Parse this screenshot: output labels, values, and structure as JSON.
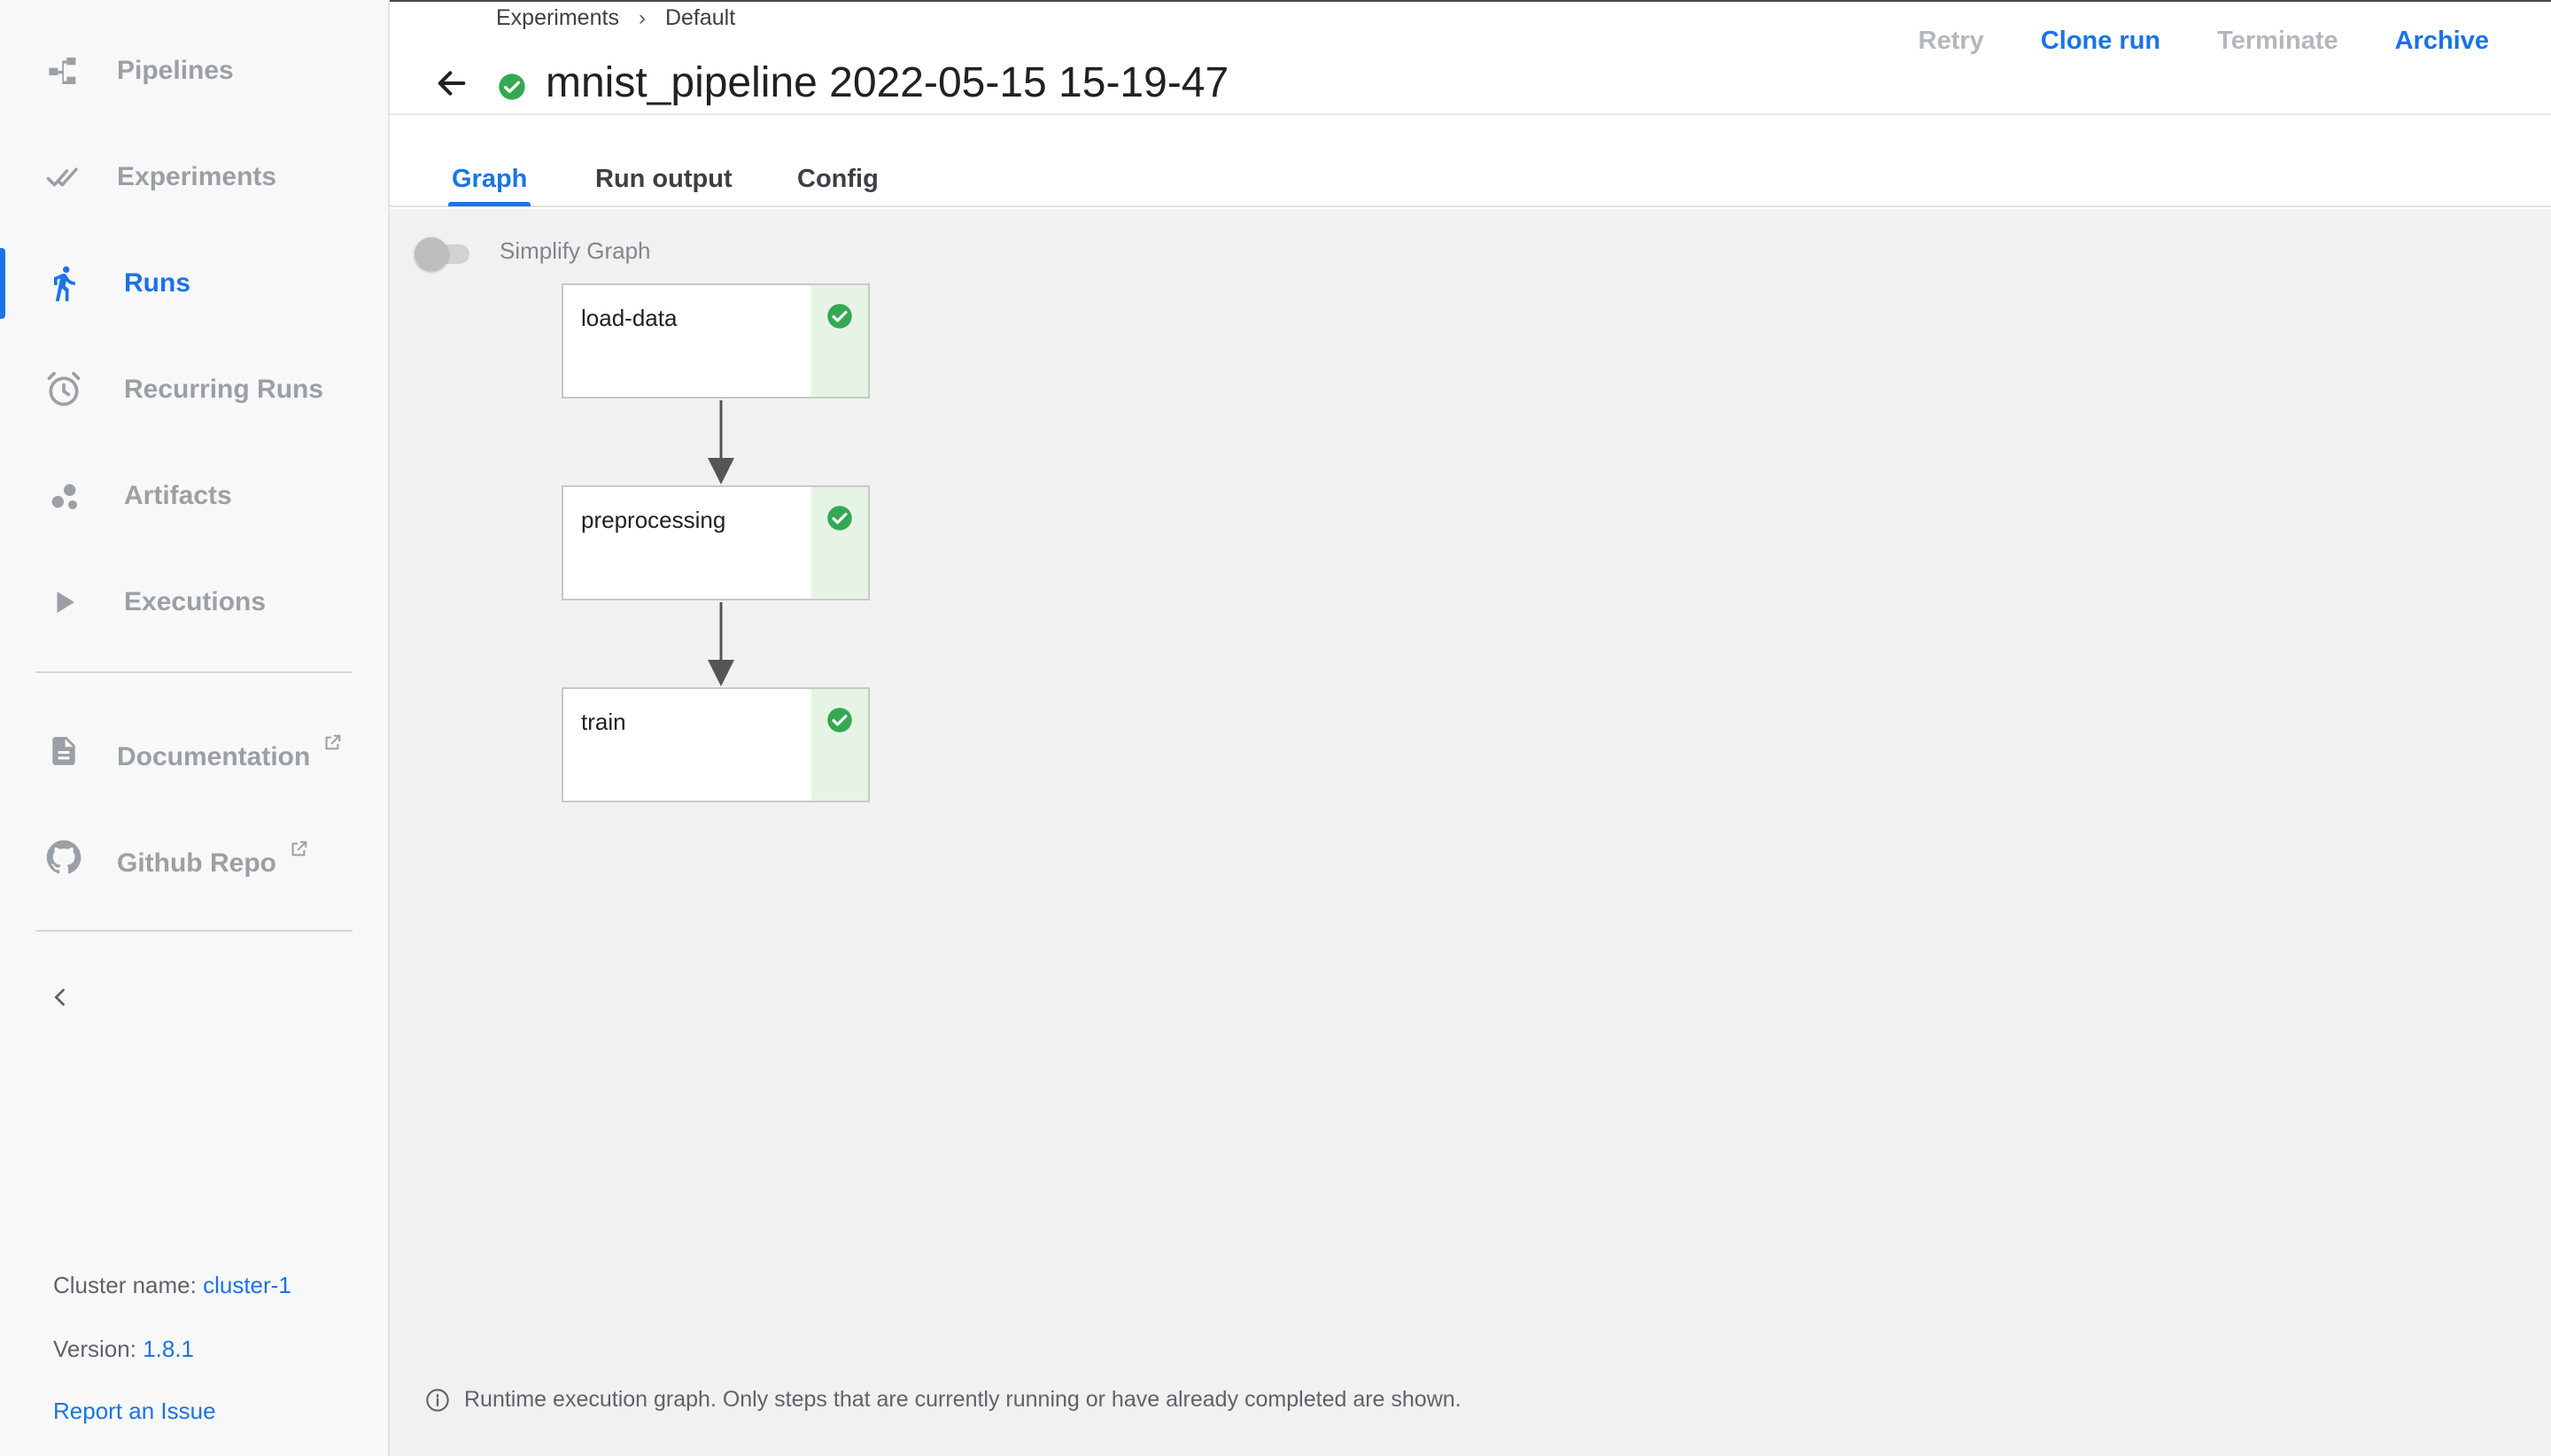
{
  "sidebar": {
    "items": [
      {
        "label": "Pipelines",
        "icon": "pipelines-icon"
      },
      {
        "label": "Experiments",
        "icon": "experiments-icon"
      },
      {
        "label": "Runs",
        "icon": "runs-icon",
        "active": true
      },
      {
        "label": "Recurring Runs",
        "icon": "alarm-clock-icon"
      },
      {
        "label": "Artifacts",
        "icon": "artifacts-icon"
      },
      {
        "label": "Executions",
        "icon": "play-icon"
      }
    ],
    "links": [
      {
        "label": "Documentation",
        "icon": "document-icon"
      },
      {
        "label": "Github Repo",
        "icon": "github-icon"
      }
    ],
    "footer": {
      "cluster_label": "Cluster name:",
      "cluster_value": "cluster-1",
      "version_label": "Version:",
      "version_value": "1.8.1",
      "report_issue": "Report an Issue"
    }
  },
  "header": {
    "breadcrumb": [
      "Experiments",
      "Default"
    ],
    "title": "mnist_pipeline 2022-05-15 15-19-47",
    "status": "succeeded",
    "actions": [
      {
        "label": "Retry",
        "enabled": false
      },
      {
        "label": "Clone run",
        "enabled": true
      },
      {
        "label": "Terminate",
        "enabled": false
      },
      {
        "label": "Archive",
        "enabled": true
      }
    ]
  },
  "tabs": [
    {
      "label": "Graph",
      "active": true
    },
    {
      "label": "Run output",
      "active": false
    },
    {
      "label": "Config",
      "active": false
    }
  ],
  "graph": {
    "simplify_toggle": {
      "label": "Simplify Graph",
      "on": false
    },
    "nodes": [
      {
        "label": "load-data",
        "status": "succeeded"
      },
      {
        "label": "preprocessing",
        "status": "succeeded"
      },
      {
        "label": "train",
        "status": "succeeded"
      }
    ],
    "info": "Runtime execution graph. Only steps that are currently running or have already completed are shown."
  },
  "colors": {
    "accent": "#1a73e8",
    "success": "#34a853",
    "success_bg": "#e6f4e6",
    "muted": "#9aa0a6"
  }
}
